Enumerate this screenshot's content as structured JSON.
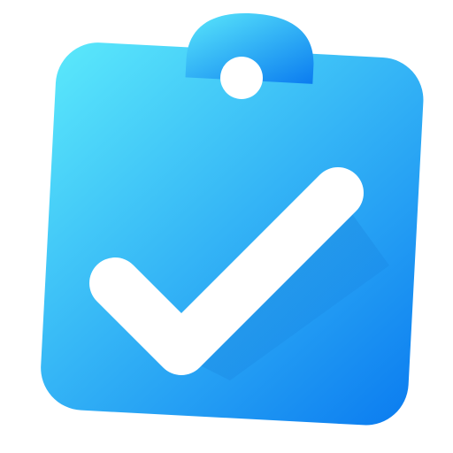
{
  "icon": {
    "name": "clipboard-check-icon",
    "colors": {
      "gradient_start": "#5be9fb",
      "gradient_end": "#0b7cf0",
      "check_fill": "#ffffff",
      "shadow": "#0a5fc0"
    }
  }
}
